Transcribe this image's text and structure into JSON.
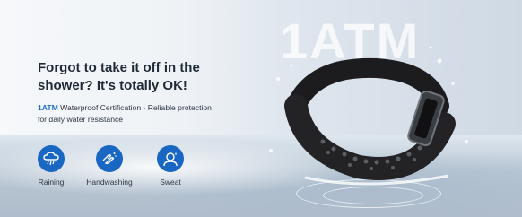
{
  "watermark": "1ATM",
  "headline": "Forgot to take it off in the shower? It's totally OK!",
  "description": {
    "highlight": "1ATM",
    "text": " Waterproof Certification - Reliable protection for daily water resistance"
  },
  "features": [
    {
      "label": "Raining",
      "icon": "rain-cloud-icon"
    },
    {
      "label": "Handwashing",
      "icon": "handwashing-icon"
    },
    {
      "label": "Sweat",
      "icon": "sweat-person-icon"
    }
  ],
  "colors": {
    "accent": "#1967c2",
    "highlight": "#1f6fc6",
    "heading": "#1f2a37"
  }
}
